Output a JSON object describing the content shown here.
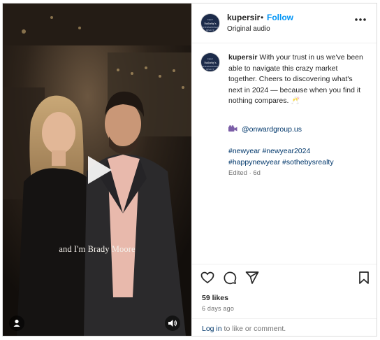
{
  "post": {
    "author": {
      "username": "kupersir",
      "separator": "•",
      "follow_label": "Follow",
      "audio_label": "Original audio",
      "avatar_logo": [
        "kuper",
        "Sotheby's",
        "INTERNATIONAL REALTY"
      ]
    },
    "media": {
      "subtitle": "and I'm Brady Moore",
      "play_icon": "play-icon",
      "tag_icon": "person-icon",
      "mute_icon": "speaker-icon"
    },
    "caption": {
      "username": "kupersir",
      "text": "With your trust in us we've been able to navigate this crazy market together. Cheers to discovering what's next in 2024 — because when you find it nothing compares. 🥂",
      "camera_icon": "video-camera-icon",
      "mention": "@onwardgroup.us",
      "hashtags_line1": "#newyear #newyear2024",
      "hashtags_line2": "#happynewyear #sothebysrealty",
      "edited": "Edited · 6d"
    },
    "stats": {
      "likes": "59 likes",
      "posted_ago": "6 days ago"
    },
    "comment": {
      "login_link": "Log in",
      "login_suffix": " to like or comment."
    },
    "colors": {
      "accent": "#0095f6",
      "link": "#00376b",
      "muted": "#737373"
    }
  }
}
